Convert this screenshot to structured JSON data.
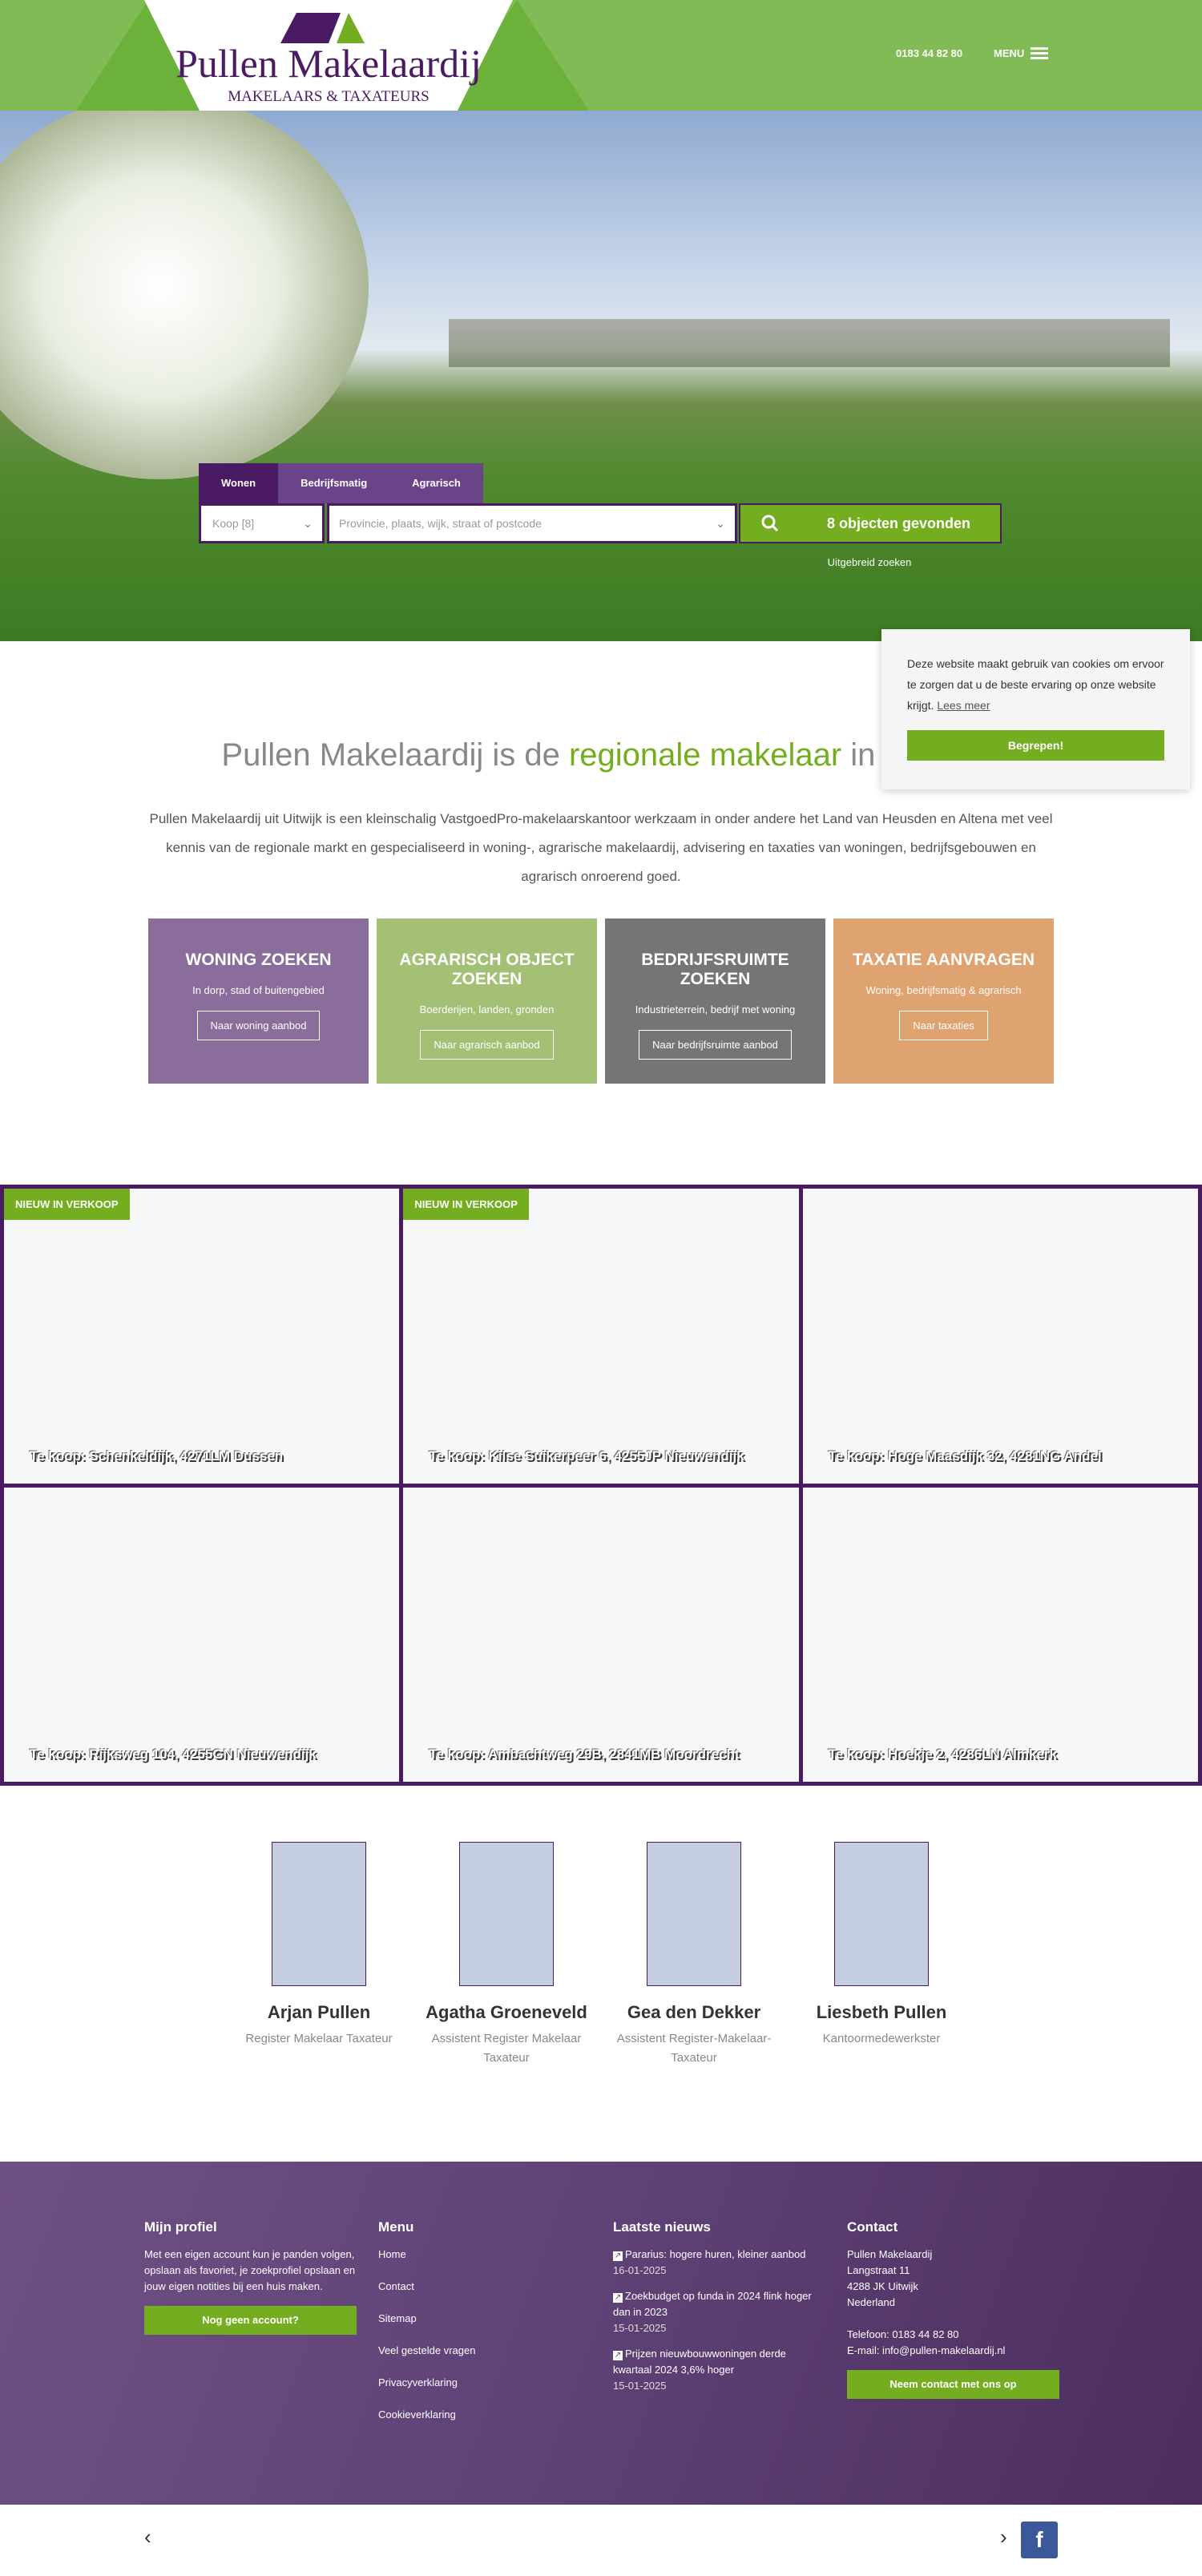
{
  "header": {
    "logo_text": "Pullen Makelaardij",
    "logo_sub": "MAKELAARS & TAXATEURS",
    "phone": "0183 44 82 80",
    "menu_label": "MENU"
  },
  "search": {
    "tabs": [
      "Wonen",
      "Bedrijfsmatig",
      "Agrarisch"
    ],
    "active_tab": "Wonen",
    "type_value": "Koop [8]",
    "location_placeholder": "Provincie, plaats, wijk, straat of postcode",
    "button_label": "8 objecten gevonden",
    "advanced_link": "Uitgebreid zoeken"
  },
  "intro": {
    "heading_pre": "Pullen Makelaardij is de ",
    "heading_bold": "regionale makelaar",
    "heading_post": " in omgev",
    "paragraph": "Pullen Makelaardij uit Uitwijk is een kleinschalig VastgoedPro-makelaarskantoor werkzaam in onder andere het Land van Heusden en Altena met veel kennis van de regionale markt en gespecialiseerd in woning-, agrarische makelaardij, advisering en taxaties van woningen, bedrijfsgebouwen en agrarisch onroerend goed."
  },
  "cards": [
    {
      "title": "WONING ZOEKEN",
      "subtitle": "In dorp, stad of buitengebied",
      "button": "Naar woning aanbod",
      "color": "#8a6d9b"
    },
    {
      "title": "AGRARISCH OBJECT ZOEKEN",
      "subtitle": "Boerderijen, landen, gronden",
      "button": "Naar agrarisch aanbod",
      "color": "#a3c075"
    },
    {
      "title": "BEDRIJFSRUIMTE ZOEKEN",
      "subtitle": "Industrieterrein, bedrijf met woning",
      "button": "Naar bedrijfsruimte aanbod",
      "color": "#757575"
    },
    {
      "title": "TAXATIE AANVRAGEN",
      "subtitle": "Woning, bedrijfsmatig & agrarisch",
      "button": "Naar taxaties",
      "color": "#dfa371"
    }
  ],
  "listings": [
    {
      "badge": "NIEUW IN VERKOOP",
      "caption": "Te koop: Schenkeldijk, 4271LM Dussen"
    },
    {
      "badge": "NIEUW IN VERKOOP",
      "caption": "Te koop: Kilse Suikerpeer 6, 4255JP Nieuwendijk"
    },
    {
      "badge": "",
      "caption": "Te koop: Hoge Maasdijk 32, 4281NG Andel"
    },
    {
      "badge": "",
      "caption": "Te koop: Rijksweg 104, 4255GN Nieuwendijk"
    },
    {
      "badge": "",
      "caption": "Te koop: Ambachtweg 29B, 2841MB Moordrecht"
    },
    {
      "badge": "",
      "caption": "Te koop: Hoekje 2, 4286LN Almkerk"
    }
  ],
  "team": [
    {
      "name": "Arjan Pullen",
      "role": "Register Makelaar Taxateur"
    },
    {
      "name": "Agatha Groeneveld",
      "role": "Assistent Register Makelaar Taxateur"
    },
    {
      "name": "Gea den Dekker",
      "role": "Assistent Register-Makelaar-Taxateur"
    },
    {
      "name": "Liesbeth Pullen",
      "role": "Kantoormedewerkster"
    }
  ],
  "footer": {
    "profile": {
      "title": "Mijn profiel",
      "text": "Met een eigen account kun je panden volgen, opslaan als favoriet, je zoekprofiel opslaan en jouw eigen notities bij een huis maken.",
      "button": "Nog geen account?"
    },
    "menu": {
      "title": "Menu",
      "items": [
        "Home",
        "Contact",
        "Sitemap",
        "Veel gestelde vragen",
        "Privacyverklaring",
        "Cookieverklaring"
      ]
    },
    "news": {
      "title": "Laatste nieuws",
      "items": [
        {
          "title": "Pararius: hogere huren, kleiner aanbod",
          "date": "16-01-2025"
        },
        {
          "title": "Zoekbudget op funda in 2024 flink hoger dan in 2023",
          "date": "15-01-2025"
        },
        {
          "title": "Prijzen nieuwbouwwoningen derde kwartaal 2024 3,6% hoger",
          "date": "15-01-2025"
        }
      ]
    },
    "contact": {
      "title": "Contact",
      "lines": [
        "Pullen Makelaardij",
        "Langstraat 11",
        "4288 JK Uitwijk",
        "Nederland"
      ],
      "phone": "Telefoon: 0183 44 82 80",
      "email": "E-mail: info@pullen-makelaardij.nl",
      "button": "Neem contact met ons op"
    }
  },
  "cookie": {
    "text": "Deze website maakt gebruik van cookies om ervoor te zorgen dat u de beste ervaring op onze website krijgt.",
    "link": "Lees meer",
    "button": "Begrepen!"
  },
  "bottom": {
    "prev": "‹",
    "next": "›",
    "facebook": "f"
  },
  "colors": {
    "primary": "#4a1a63",
    "accent": "#74ad1f",
    "header_green": "#80bb55",
    "facebook": "#3b5998"
  }
}
